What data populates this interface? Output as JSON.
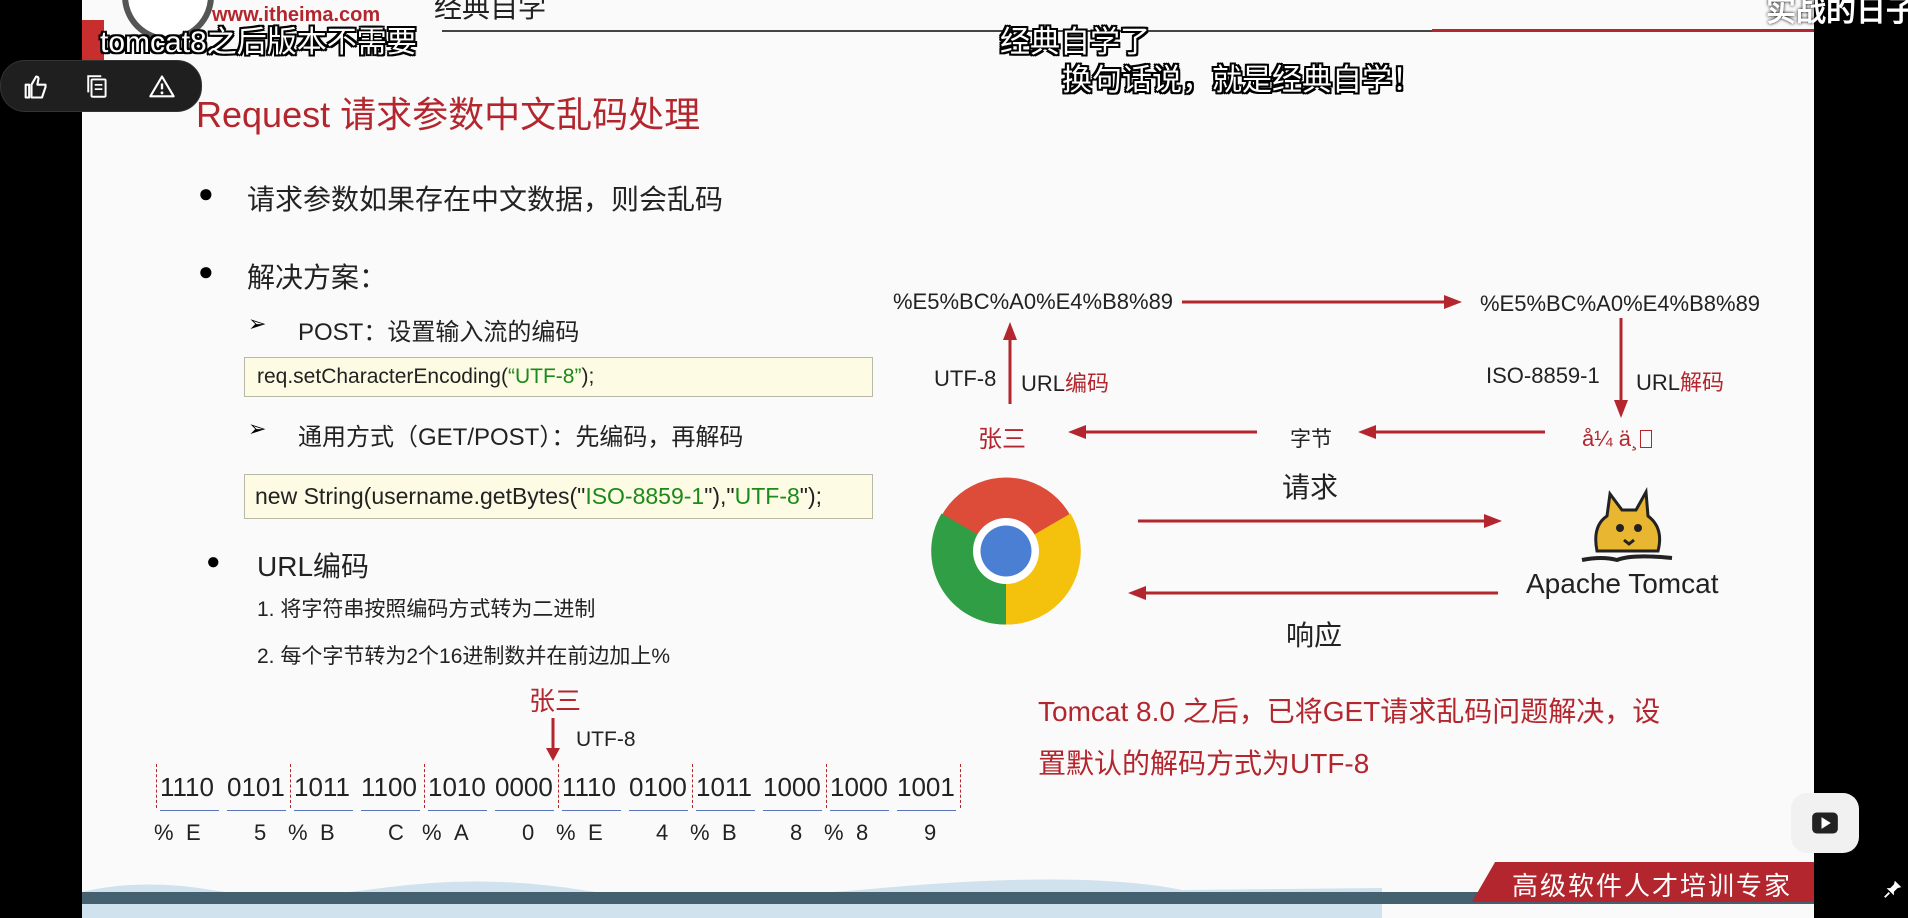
{
  "header": {
    "logo_url_text": "www.itheima.com",
    "logo_tagline": "经典自学",
    "top_banner_text": "实战的日子"
  },
  "subtitles": {
    "line1": "tomcat8之后版本不需要",
    "line2": "经典自学了",
    "line3": "换句话说，就是经典自学！"
  },
  "toolbar": {
    "like_icon": "thumb-up-icon",
    "copy_icon": "copy-icon",
    "report_icon": "warning-icon"
  },
  "slide": {
    "title": "Request 请求参数中文乱码处理",
    "bullet1": "请求参数如果存在中文数据，则会乱码",
    "bullet2": "解决方案：",
    "sub1": "POST：设置输入流的编码",
    "code1": {
      "prefix": "req.setCharacterEncoding(",
      "arg": "“UTF-8”",
      "suffix": ");"
    },
    "sub2": "通用方式（GET/POST）：先编码，再解码",
    "code2": {
      "prefix": "new String(username.getBytes(\"",
      "arg1": "ISO-8859-1",
      "mid": "\"),\"",
      "arg2": "UTF-8",
      "suffix": "\");"
    },
    "bullet3": "URL编码",
    "step1": "1. 将字符串按照编码方式转为二进制",
    "step2": "2. 每个字节转为2个16进制数并在前边加上%",
    "name_label": "张三",
    "utf8_label": "UTF-8",
    "binary": [
      "1110",
      "0101",
      "1011",
      "1100",
      "1010",
      "0000",
      "1110",
      "0100",
      "1011",
      "1000",
      "1000",
      "1001"
    ],
    "hex": [
      "%",
      "E",
      "5",
      "%",
      "B",
      "C",
      "%",
      "A",
      "0",
      "%",
      "E",
      "4",
      "%",
      "B",
      "8",
      "%",
      "8",
      "9"
    ]
  },
  "diagram": {
    "encoded_left": "%E5%BC%A0%E4%B8%89",
    "encoded_right": "%E5%BC%A0%E4%B8%89",
    "utf8": "UTF-8",
    "url_encode_prefix": "URL",
    "url_encode_suffix": "编码",
    "iso": "ISO-8859-1",
    "url_decode_prefix": "URL",
    "url_decode_suffix": "解码",
    "zhangsan": "张三",
    "bytes": "字节",
    "garbled": "å¼ ä¸",
    "request": "请求",
    "response": "响应",
    "tomcat_label": "Apache Tomcat",
    "browser_icon": "chrome-icon",
    "server_icon": "tomcat-cat-icon"
  },
  "note": {
    "line1": "Tomcat 8.0 之后，已将GET请求乱码问题解决，设",
    "line2": "置默认的解码方式为UTF-8"
  },
  "footer": {
    "slogan": "高级软件人才培训专家"
  },
  "colors": {
    "accent_red": "#b3262e",
    "code_green": "#1a8a1a",
    "code_bg": "#fdfbe3"
  }
}
